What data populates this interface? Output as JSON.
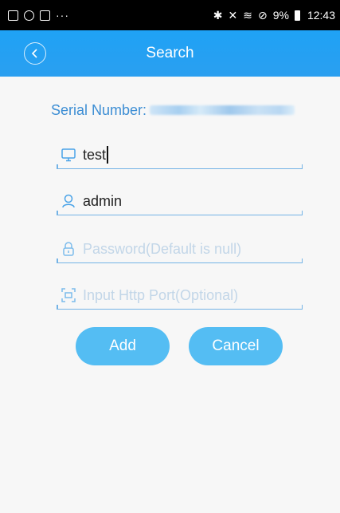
{
  "status_bar": {
    "right_text": "9%",
    "time": "12:43"
  },
  "header": {
    "title": "Search"
  },
  "serial": {
    "label": "Serial Number:"
  },
  "form": {
    "device_name_value": "test",
    "username_value": "admin",
    "password_placeholder": "Password(Default is null)",
    "http_port_placeholder": "Input Http Port(Optional)"
  },
  "actions": {
    "add_label": "Add",
    "cancel_label": "Cancel"
  },
  "colors": {
    "header_blue": "#1fa2f5",
    "button_blue": "#54bdf3",
    "label_blue": "#3d8ed4"
  }
}
